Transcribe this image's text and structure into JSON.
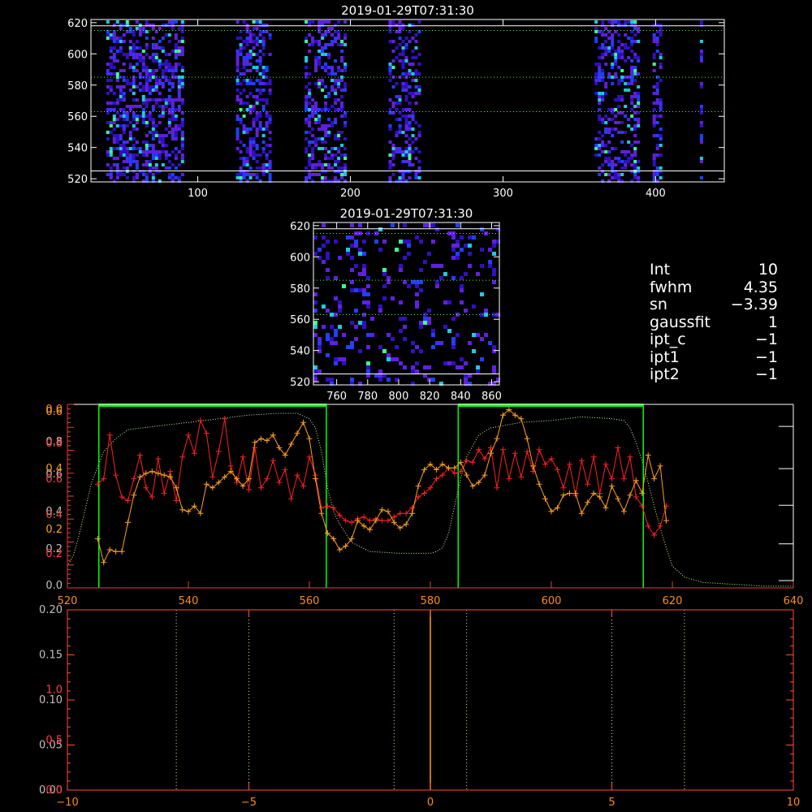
{
  "chart_data": [
    {
      "type": "heatmap",
      "title": "2019-01-29T07:31:30",
      "xlim": [
        30,
        445
      ],
      "ylim": [
        518,
        622
      ],
      "x_ticks": [
        100,
        200,
        300,
        400
      ],
      "y_ticks": [
        520,
        540,
        560,
        580,
        600,
        620
      ],
      "guide_lines_dotted": [
        563,
        585,
        615
      ],
      "guide_lines_solid": [
        525,
        618
      ],
      "active_column_bands": [
        [
          40,
          90
        ],
        [
          125,
          147
        ],
        [
          170,
          197
        ],
        [
          225,
          245
        ],
        [
          360,
          388
        ],
        [
          398,
          404
        ],
        [
          429,
          431
        ]
      ],
      "colors": [
        "#3010c0",
        "#6020e0",
        "#2040ff",
        "#20c8e0",
        "#40ff90"
      ]
    },
    {
      "type": "heatmap",
      "title": "2019-01-29T07:31:30",
      "xlim": [
        745,
        865
      ],
      "ylim": [
        518,
        622
      ],
      "x_ticks": [
        760,
        780,
        800,
        820,
        840,
        860
      ],
      "y_ticks": [
        520,
        540,
        560,
        580,
        600,
        620
      ],
      "guide_lines_dotted": [
        563,
        585,
        615
      ],
      "guide_lines_solid": [
        525,
        618
      ],
      "colors": [
        "#3010c0",
        "#6020e0",
        "#2040ff",
        "#20c8e0",
        "#40ff90"
      ]
    },
    {
      "type": "line",
      "xlim": [
        520,
        640
      ],
      "x_ticks": [
        520,
        540,
        560,
        580,
        600,
        620,
        640
      ],
      "left_axis_a_ticks": [
        "0.0",
        "0.2",
        "0.4",
        "0.6",
        "0.8",
        "0.0"
      ],
      "left_axis_b_ticks": [
        "0.2",
        "0.4",
        "0.6",
        "0.8"
      ],
      "left_axis_c_ticks": [
        "0.2",
        "0.4",
        "0.6"
      ],
      "green_boxes": [
        [
          525.2,
          562.8
        ],
        [
          584.6,
          615.2
        ]
      ],
      "colors": {
        "red": "#ff2020",
        "orange": "#ffa020",
        "green": "#00ff00",
        "dotted": "#c8ffa0",
        "axis_red": "#e04040"
      },
      "series": [
        {
          "color": "red",
          "x": [
            525,
            526,
            527,
            528,
            529,
            530,
            531,
            532,
            533,
            534,
            535,
            536,
            537,
            538,
            539,
            540,
            541,
            542,
            543,
            544,
            545,
            546,
            547,
            548,
            549,
            550,
            551,
            552,
            553,
            554,
            555,
            556,
            557,
            558,
            559,
            560,
            561,
            562,
            563,
            564,
            565,
            566,
            567,
            568,
            569,
            570,
            571,
            572,
            573,
            574,
            575,
            576,
            577,
            578,
            579,
            580,
            581,
            582,
            583,
            584,
            585,
            586,
            587,
            588,
            589,
            590,
            591,
            592,
            593,
            594,
            595,
            596,
            597,
            598,
            599,
            600,
            601,
            602,
            603,
            604,
            605,
            606,
            607,
            608,
            609,
            610,
            611,
            612,
            613,
            614,
            615,
            616,
            617,
            618,
            619
          ],
          "y": [
            0.57,
            0.6,
            0.84,
            0.62,
            0.5,
            0.48,
            0.6,
            0.73,
            0.55,
            0.5,
            0.71,
            0.52,
            0.64,
            0.48,
            0.72,
            0.84,
            0.74,
            0.92,
            0.85,
            0.61,
            0.75,
            0.93,
            0.67,
            0.58,
            0.72,
            0.54,
            0.77,
            0.55,
            0.6,
            0.7,
            0.58,
            0.65,
            0.49,
            0.62,
            0.56,
            0.72,
            0.62,
            0.44,
            0.45,
            0.44,
            0.4,
            0.37,
            0.36,
            0.38,
            0.39,
            0.37,
            0.38,
            0.37,
            0.37,
            0.39,
            0.41,
            0.41,
            0.44,
            0.5,
            0.52,
            0.55,
            0.6,
            0.62,
            0.66,
            0.63,
            0.64,
            0.7,
            0.69,
            0.76,
            0.71,
            0.77,
            0.55,
            0.76,
            0.6,
            0.74,
            0.61,
            0.75,
            0.64,
            0.76,
            0.68,
            0.71,
            0.65,
            0.55,
            0.68,
            0.51,
            0.7,
            0.57,
            0.72,
            0.52,
            0.68,
            0.6,
            0.77,
            0.6,
            0.72,
            0.5,
            0.45,
            0.34,
            0.29,
            0.34,
            0.45
          ]
        },
        {
          "color": "orange",
          "x": [
            525,
            526,
            527,
            528,
            529,
            530,
            531,
            532,
            533,
            534,
            535,
            536,
            537,
            538,
            539,
            540,
            541,
            542,
            543,
            544,
            545,
            546,
            547,
            548,
            549,
            550,
            551,
            552,
            553,
            554,
            555,
            556,
            557,
            558,
            559,
            560,
            561,
            562,
            563,
            564,
            565,
            566,
            567,
            568,
            569,
            570,
            571,
            572,
            573,
            574,
            575,
            576,
            577,
            578,
            579,
            580,
            581,
            582,
            583,
            584,
            585,
            586,
            587,
            588,
            589,
            590,
            591,
            592,
            593,
            594,
            595,
            596,
            597,
            598,
            599,
            600,
            601,
            602,
            603,
            604,
            605,
            606,
            607,
            608,
            609,
            610,
            611,
            612,
            613,
            614,
            615,
            616,
            617,
            618,
            619
          ],
          "y": [
            0.27,
            0.14,
            0.21,
            0.2,
            0.2,
            0.36,
            0.51,
            0.61,
            0.63,
            0.64,
            0.63,
            0.62,
            0.61,
            0.55,
            0.43,
            0.42,
            0.45,
            0.41,
            0.57,
            0.55,
            0.58,
            0.61,
            0.64,
            0.6,
            0.56,
            0.6,
            0.8,
            0.82,
            0.81,
            0.84,
            0.77,
            0.73,
            0.79,
            0.85,
            0.91,
            0.82,
            0.6,
            0.41,
            0.3,
            0.27,
            0.21,
            0.23,
            0.27,
            0.37,
            0.34,
            0.32,
            0.37,
            0.43,
            0.42,
            0.36,
            0.33,
            0.35,
            0.41,
            0.56,
            0.65,
            0.68,
            0.65,
            0.68,
            0.66,
            0.66,
            0.69,
            0.62,
            0.56,
            0.58,
            0.62,
            0.74,
            0.82,
            0.95,
            0.98,
            0.95,
            0.93,
            0.82,
            0.67,
            0.57,
            0.49,
            0.42,
            0.44,
            0.51,
            0.52,
            0.52,
            0.41,
            0.47,
            0.52,
            0.5,
            0.44,
            0.56,
            0.49,
            0.42,
            0.51,
            0.59,
            0.52,
            0.73,
            0.6,
            0.67,
            0.37
          ]
        },
        {
          "color": "dotted",
          "x": [
            520,
            521,
            522,
            524,
            526,
            528,
            530,
            535,
            540,
            545,
            550,
            555,
            558,
            560,
            561,
            562,
            563,
            564,
            565,
            567,
            570,
            575,
            580,
            581,
            582,
            583,
            584,
            585,
            586,
            588,
            590,
            595,
            600,
            605,
            610,
            612,
            613,
            614,
            615,
            616,
            617,
            618,
            619,
            620,
            622,
            625,
            630,
            635,
            640
          ],
          "y": [
            0.12,
            0.18,
            0.3,
            0.58,
            0.75,
            0.82,
            0.87,
            0.89,
            0.91,
            0.93,
            0.95,
            0.96,
            0.96,
            0.93,
            0.88,
            0.75,
            0.55,
            0.42,
            0.35,
            0.25,
            0.2,
            0.19,
            0.19,
            0.2,
            0.22,
            0.3,
            0.45,
            0.6,
            0.72,
            0.84,
            0.88,
            0.91,
            0.92,
            0.94,
            0.93,
            0.92,
            0.88,
            0.8,
            0.7,
            0.58,
            0.45,
            0.33,
            0.22,
            0.12,
            0.06,
            0.03,
            0.02,
            0.01,
            0.01
          ]
        }
      ]
    },
    {
      "type": "line",
      "xlim": [
        -10,
        10
      ],
      "x_ticks": [
        -10,
        -5,
        0,
        5,
        10
      ],
      "left_axis_a_ticks": [
        "0.00",
        "0.05",
        "0.10",
        "0.15",
        "0.20"
      ],
      "left_axis_b_ticks": [
        "0.0",
        "0.5",
        "1.0"
      ],
      "dotted_lines_x": [
        -7,
        -5,
        -1,
        1,
        5,
        7
      ],
      "solid_line_x": 0,
      "colors": {
        "axis": "#ff5030",
        "dotted": "#f0e68c",
        "solid": "#ffa020"
      }
    }
  ],
  "info": {
    "rows": [
      {
        "key": "Int",
        "value": "10"
      },
      {
        "key": "fwhm",
        "value": "4.35"
      },
      {
        "key": "sn",
        "value": "−3.39"
      },
      {
        "key": "gaussfit",
        "value": "1"
      },
      {
        "key": "ipt_c",
        "value": "−1"
      },
      {
        "key": "ipt1",
        "value": "−1"
      },
      {
        "key": "ipt2",
        "value": "−1"
      }
    ]
  }
}
